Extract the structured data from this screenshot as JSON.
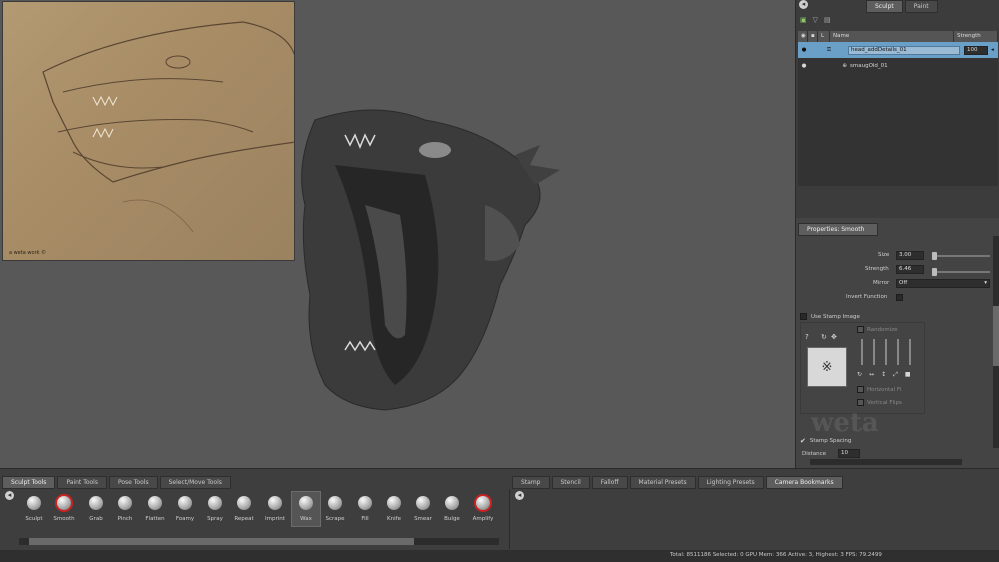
{
  "reference_image": {
    "caption": "a weta work ©"
  },
  "right_panel": {
    "tabs": [
      {
        "label": "Sculpt"
      },
      {
        "label": "Paint"
      }
    ],
    "layer_headers": {
      "name": "Name",
      "strength": "Strength"
    },
    "layers": [
      {
        "name": "head_addDetails_01",
        "strength": "100",
        "selected": true
      },
      {
        "name": "smaugOld_01"
      }
    ],
    "properties": {
      "tab_label": "Properties: Smooth",
      "size_label": "Size",
      "size_value": "3.00",
      "strength_label": "Strength",
      "strength_value": "6.46",
      "mirror_label": "Mirror",
      "mirror_value": "Off",
      "invert_label": "Invert Function",
      "use_stamp_label": "Use Stamp Image",
      "randomize_label": "Randomize",
      "horizontal_label": "Horizontal Fl",
      "vertical_label": "Vertical Flips",
      "stamp_spacing_label": "Stamp Spacing",
      "distance_label": "Distance",
      "distance_value": "10"
    },
    "watermark": "weta"
  },
  "bottom": {
    "left_tabs": [
      {
        "label": "Sculpt Tools"
      },
      {
        "label": "Paint Tools"
      },
      {
        "label": "Pose Tools"
      },
      {
        "label": "Select/Move Tools"
      }
    ],
    "right_tabs": [
      {
        "label": "Stamp"
      },
      {
        "label": "Stencil"
      },
      {
        "label": "Falloff"
      },
      {
        "label": "Material Presets"
      },
      {
        "label": "Lighting Presets"
      },
      {
        "label": "Camera Bookmarks"
      }
    ],
    "tools": [
      {
        "label": "Sculpt"
      },
      {
        "label": "Smooth"
      },
      {
        "label": "Grab"
      },
      {
        "label": "Pinch"
      },
      {
        "label": "Flatten"
      },
      {
        "label": "Foamy"
      },
      {
        "label": "Spray"
      },
      {
        "label": "Repeat"
      },
      {
        "label": "Imprint"
      },
      {
        "label": "Wax"
      },
      {
        "label": "Scrape"
      },
      {
        "label": "Fill"
      },
      {
        "label": "Knife"
      },
      {
        "label": "Smear"
      },
      {
        "label": "Bulge"
      },
      {
        "label": "Amplify"
      }
    ]
  },
  "status": {
    "text": "Total: 8511186  Selected: 0  GPU Mem: 366  Active: 3, Highest: 3  FPS: 79.2499"
  },
  "colors": {
    "selection": "#6a9fc8",
    "viewport": "#585858",
    "panel": "#3c3c3c"
  }
}
